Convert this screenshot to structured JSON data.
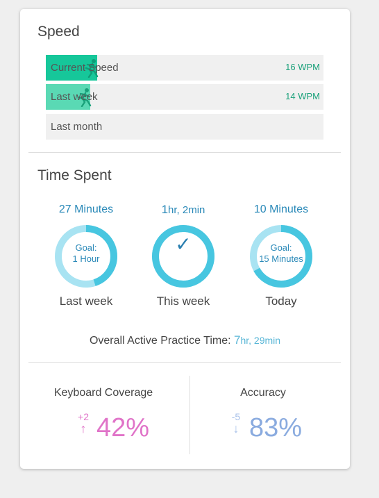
{
  "speed": {
    "title": "Speed",
    "bars": [
      {
        "label": "Current Speed",
        "value": "16 WPM",
        "fill_fraction": 0.18,
        "color": "#16c79a"
      },
      {
        "label": "Last week",
        "value": "14 WPM",
        "fill_fraction": 0.16,
        "color": "#5ad9b4"
      },
      {
        "label": "Last month",
        "value": "",
        "fill_fraction": 0,
        "color": "#f0f0f0"
      }
    ]
  },
  "time_spent": {
    "title": "Time Spent",
    "columns": [
      {
        "top_num": "27",
        "top_unit": " Minutes",
        "goal_line1": "Goal:",
        "goal_line2": "1 Hour",
        "label": "Last week",
        "progress": 0.45
      },
      {
        "top_num": "1",
        "top_unit": "hr, 2min",
        "goal_line1": "✓",
        "goal_line2": "",
        "label": "This week",
        "progress": 1.0
      },
      {
        "top_num": "10",
        "top_unit": " Minutes",
        "goal_line1": "Goal:",
        "goal_line2": "15 Minutes",
        "label": "Today",
        "progress": 0.67
      }
    ],
    "overall_label": "Overall Active Practice Time: ",
    "overall_num": "7",
    "overall_unit": "hr, 29min"
  },
  "keyboard_coverage": {
    "title": "Keyboard Coverage",
    "delta": "+2",
    "direction": "up",
    "value": "42%",
    "color": "#e073c8"
  },
  "accuracy": {
    "title": "Accuracy",
    "delta": "-5",
    "direction": "down",
    "value": "83%",
    "color": "#8aabdf"
  },
  "colors": {
    "ring_bg": "#a8e3f2",
    "ring_fg": "#47c6e0",
    "accent_text": "#2a89b8"
  }
}
